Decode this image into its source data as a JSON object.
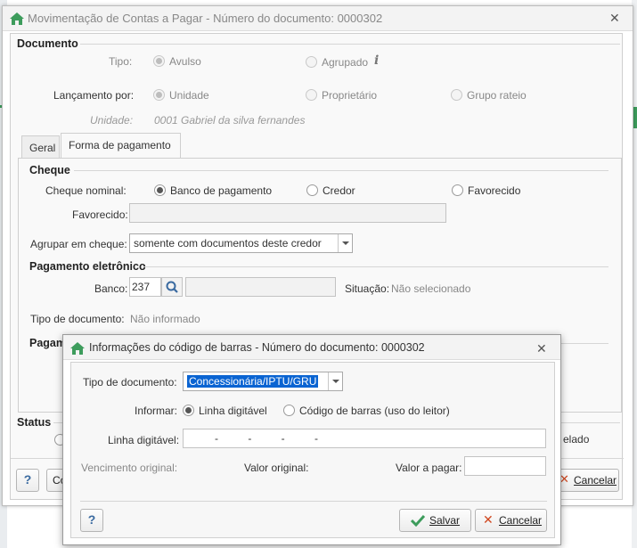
{
  "main_window": {
    "title": "Movimentação de Contas a Pagar - Número do documento: 0000302",
    "documento": {
      "section": "Documento",
      "tipo_label": "Tipo:",
      "tipo_options": [
        "Avulso",
        "Agrupado"
      ],
      "tipo_selected": "Avulso",
      "lancamento_label": "Lançamento por:",
      "lancamento_options": [
        "Unidade",
        "Proprietário",
        "Grupo rateio"
      ],
      "lancamento_selected": "Unidade",
      "unidade_label": "Unidade:",
      "unidade_value": "0001 Gabriel da silva fernandes"
    },
    "tabs": [
      "Geral",
      "Forma de pagamento"
    ],
    "active_tab": "Forma de pagamento",
    "cheque": {
      "section": "Cheque",
      "nominal_label": "Cheque nominal:",
      "nominal_options": [
        "Banco de pagamento",
        "Credor",
        "Favorecido"
      ],
      "nominal_selected": "Banco de pagamento",
      "favorecido_label": "Favorecido:",
      "favorecido_value": "",
      "agrupar_label": "Agrupar em cheque:",
      "agrupar_value": "somente com documentos deste credor"
    },
    "pagamento_eletronico": {
      "section": "Pagamento eletrônico",
      "banco_label": "Banco:",
      "banco_code": "237",
      "banco_name": "",
      "situacao_label": "Situação:",
      "situacao_value": "Não selecionado",
      "tipo_doc_label": "Tipo de documento:",
      "tipo_doc_value": "Não informado"
    },
    "partial_section": "Pagam",
    "status": {
      "section": "Status",
      "partial_option": "elado"
    },
    "help_label": "?",
    "partial_button": "Co",
    "cancel_label": "Cancelar"
  },
  "dialog": {
    "title": "Informações do código de barras - Número do documento: 0000302",
    "tipo_doc_label": "Tipo de documento:",
    "tipo_doc_value": "Concessionária/IPTU/GRU",
    "informar_label": "Informar:",
    "informar_options": [
      "Linha digitável",
      "Código de barras (uso do leitor)"
    ],
    "informar_selected": "Linha digitável",
    "linha_label": "Linha digitável:",
    "linha_mask": "-          -          -          -",
    "vencimento_label": "Vencimento original:",
    "valor_original_label": "Valor original:",
    "valor_pagar_label": "Valor a pagar:",
    "valor_pagar_value": "",
    "help_label": "?",
    "save_label": "Salvar",
    "cancel_label": "Cancelar"
  },
  "colors": {
    "accent_green": "#3d9c5c",
    "selection_blue": "#0a64d2",
    "cancel_red": "#d0471f"
  }
}
